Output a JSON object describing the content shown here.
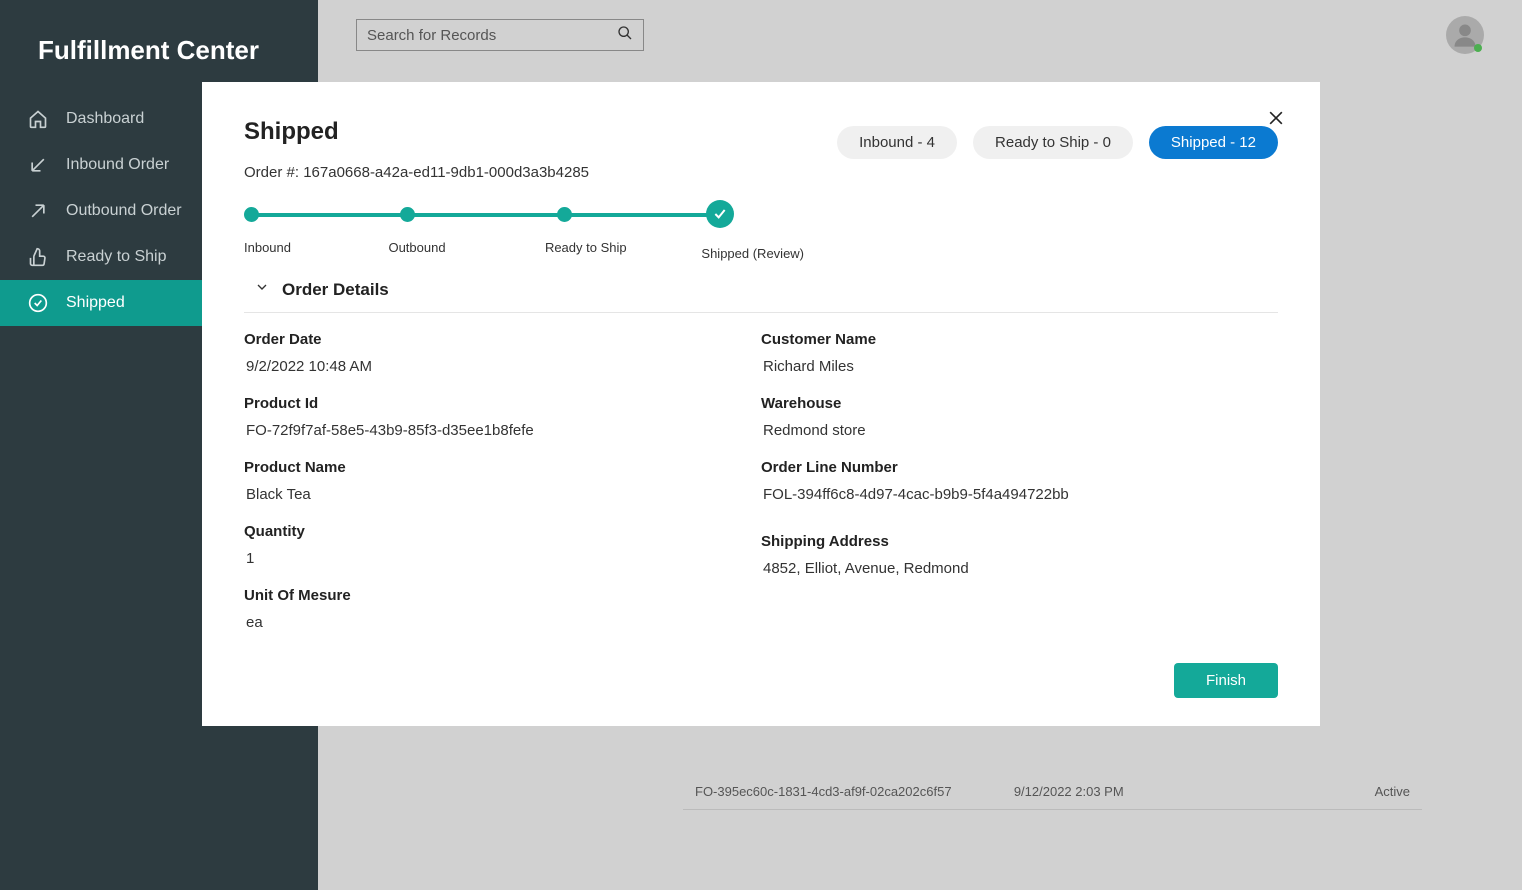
{
  "sidebar": {
    "title": "Fulfillment Center",
    "nav": [
      {
        "label": "Dashboard",
        "icon": "home"
      },
      {
        "label": "Inbound Order",
        "icon": "arrow-in"
      },
      {
        "label": "Outbound Order",
        "icon": "arrow-out"
      },
      {
        "label": "Ready to Ship",
        "icon": "thumbs-up"
      },
      {
        "label": "Shipped",
        "icon": "check-circle",
        "active": true
      }
    ]
  },
  "topbar": {
    "search_placeholder": "Search for Records"
  },
  "bg_table": {
    "rows": [
      {
        "id": "FO-395ec60c-1831-4cd3-af9f-02ca202c6f57",
        "date": "9/12/2022 2:03 PM",
        "status": "Active"
      }
    ]
  },
  "modal": {
    "title": "Shipped",
    "order_number_label": "Order #:",
    "order_number": "167a0668-a42a-ed11-9db1-000d3a3b4285",
    "pills": [
      {
        "label": "Inbound - 4"
      },
      {
        "label": "Ready to Ship - 0"
      },
      {
        "label": "Shipped - 12",
        "active": true
      }
    ],
    "stepper": [
      {
        "label": "Inbound",
        "done": true
      },
      {
        "label": "Outbound",
        "done": true
      },
      {
        "label": "Ready to Ship",
        "done": true
      },
      {
        "label": "Shipped (Review)",
        "done": true,
        "current": true
      }
    ],
    "section_title": "Order Details",
    "fields_left": [
      {
        "label": "Order Date",
        "value": "9/2/2022 10:48 AM"
      },
      {
        "label": "Product Id",
        "value": "FO-72f9f7af-58e5-43b9-85f3-d35ee1b8fefe"
      },
      {
        "label": "Product Name",
        "value": "Black Tea"
      },
      {
        "label": "Quantity",
        "value": "1"
      },
      {
        "label": "Unit Of Mesure",
        "value": "ea"
      }
    ],
    "fields_right": [
      {
        "label": "Customer Name",
        "value": "Richard Miles"
      },
      {
        "label": "Warehouse",
        "value": "Redmond store"
      },
      {
        "label": "Order Line Number",
        "value": "FOL-394ff6c8-4d97-4cac-b9b9-5f4a494722bb"
      },
      {
        "label": "Shipping Address",
        "value": "4852, Elliot, Avenue, Redmond"
      }
    ],
    "finish_label": "Finish"
  }
}
